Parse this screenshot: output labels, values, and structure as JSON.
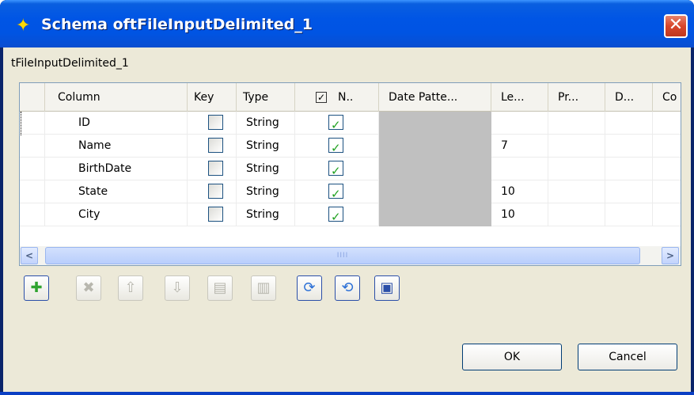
{
  "window": {
    "title": "Schema oftFileInputDelimited_1",
    "close_glyph": "✕"
  },
  "component_label": "tFileInputDelimited_1",
  "table": {
    "columns": [
      "Column",
      "Key",
      "Type",
      "N..",
      "Date Patte...",
      "Le...",
      "Pr...",
      "D...",
      "Co"
    ],
    "header_nullable_check": "✓",
    "rows": [
      {
        "column": "ID",
        "key": false,
        "type": "String",
        "nullable": true,
        "date_pattern": "",
        "length": ""
      },
      {
        "column": "Name",
        "key": false,
        "type": "String",
        "nullable": true,
        "date_pattern": "",
        "length": "7"
      },
      {
        "column": "BirthDate",
        "key": false,
        "type": "String",
        "nullable": true,
        "date_pattern": "",
        "length": ""
      },
      {
        "column": "State",
        "key": false,
        "type": "String",
        "nullable": true,
        "date_pattern": "",
        "length": "10"
      },
      {
        "column": "City",
        "key": false,
        "type": "String",
        "nullable": true,
        "date_pattern": "",
        "length": "10"
      }
    ],
    "scroll": {
      "left_arrow": "<",
      "right_arrow": ">",
      "thumb_grip": "IIII"
    }
  },
  "toolbar": {
    "add": "✚",
    "remove": "✖",
    "move_up": "⇧",
    "move_down": "⇩",
    "copy": "▤",
    "paste": "▥",
    "import": "⟳",
    "export": "⟲",
    "save": "▣"
  },
  "buttons": {
    "ok": "OK",
    "cancel": "Cancel"
  },
  "colors": {
    "titlebar": "#0054e3",
    "client": "#ece9d8",
    "checkmark": "#21a121",
    "close": "#d8462b"
  }
}
